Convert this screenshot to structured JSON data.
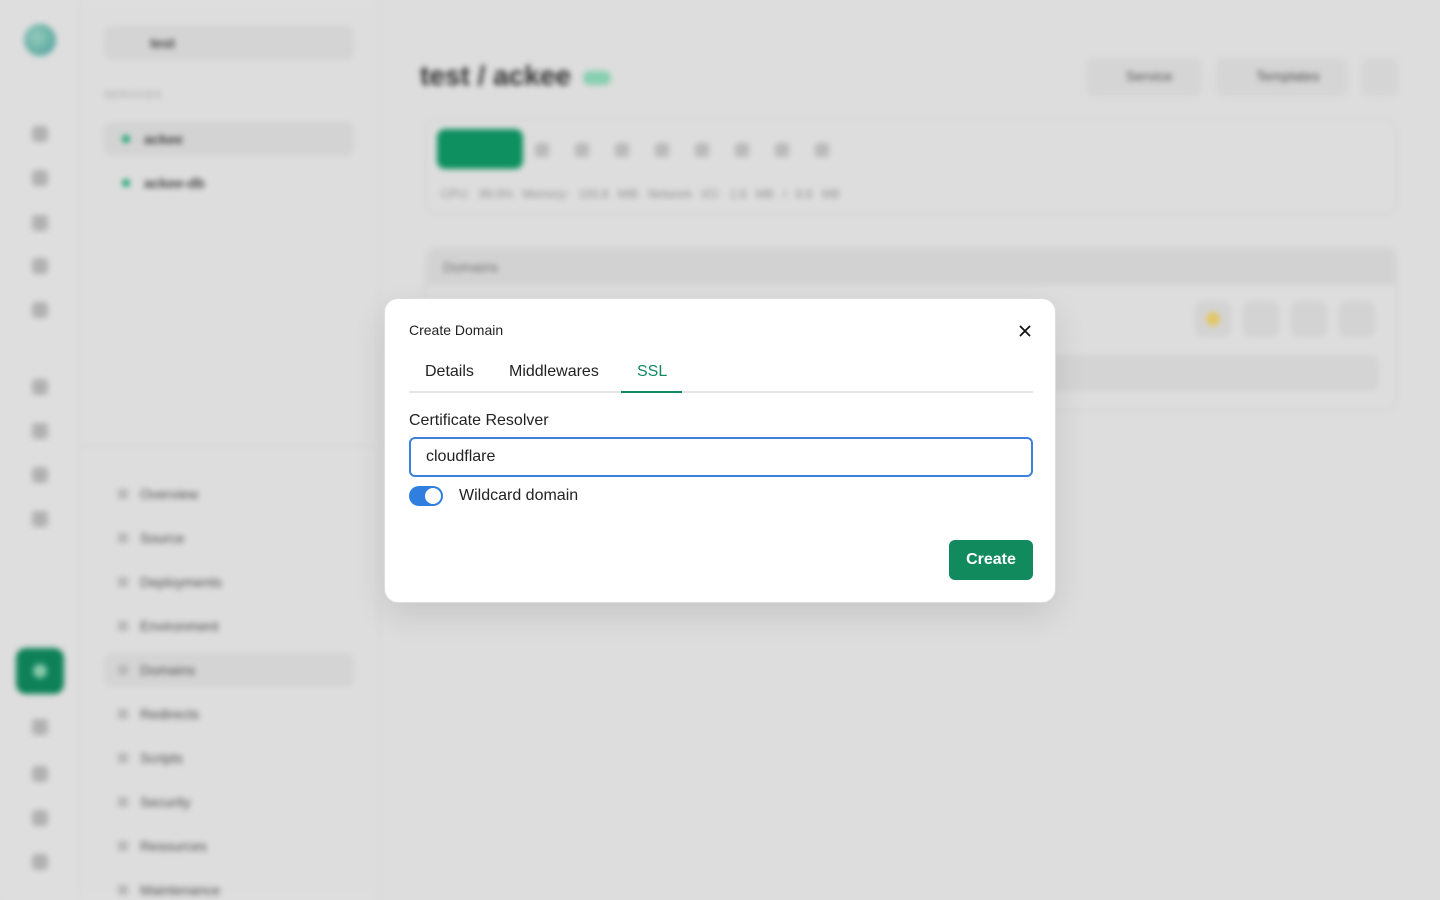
{
  "background": {
    "project_name": "test",
    "services_section": "SERVICES",
    "services": [
      "ackee",
      "ackee-db"
    ],
    "menu": [
      "Overview",
      "Source",
      "Deployments",
      "Environment",
      "Domains",
      "Redirects",
      "Scripts",
      "Security",
      "Resources",
      "Maintenance"
    ],
    "selected_menu": "Domains",
    "page_title": "test / ackee",
    "top_buttons": [
      "Service",
      "Templates"
    ],
    "stats": "CPU: 99.0%  Memory: 155.8 MiB  Network I/O: 1.8 MB / 8.8 MB",
    "domains_header": "Domains"
  },
  "modal": {
    "title": "Create Domain",
    "close_icon": "close-icon",
    "tabs": [
      {
        "label": "Details",
        "active": false
      },
      {
        "label": "Middlewares",
        "active": false
      },
      {
        "label": "SSL",
        "active": true
      }
    ],
    "certificate_resolver": {
      "label": "Certificate Resolver",
      "value": "cloudflare"
    },
    "wildcard": {
      "label": "Wildcard domain",
      "enabled": true
    },
    "create_label": "Create"
  },
  "colors": {
    "accent": "#118a5d",
    "focus": "#3c82dc",
    "toggle_on": "#2f7fe0"
  }
}
